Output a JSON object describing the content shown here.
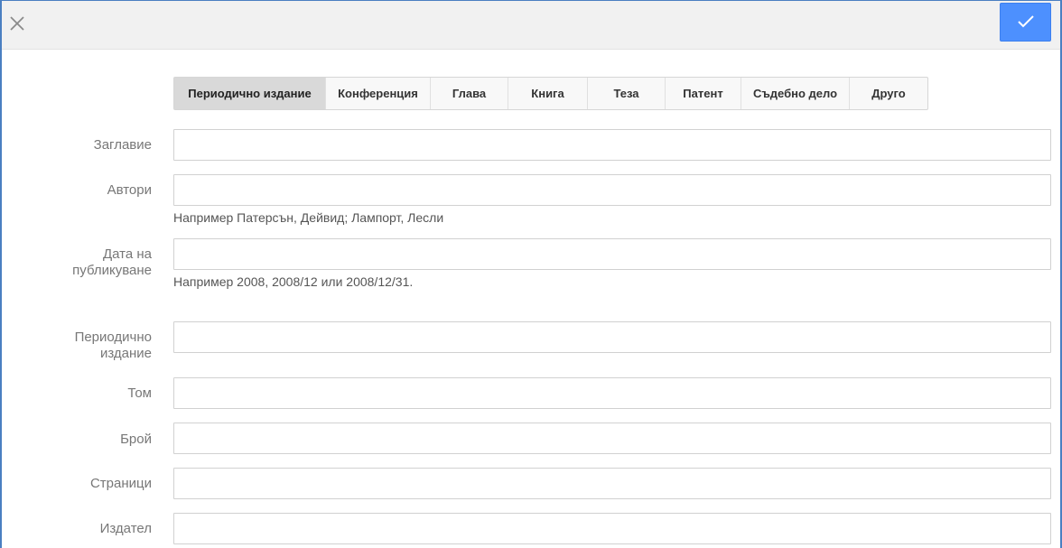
{
  "toolbar": {
    "close_icon": "close-icon",
    "save_icon": "checkmark-icon",
    "accent_color": "#4d90fe"
  },
  "tabs": [
    {
      "label": "Периодично издание",
      "active": true
    },
    {
      "label": "Конференция",
      "active": false
    },
    {
      "label": "Глава",
      "active": false
    },
    {
      "label": "Книга",
      "active": false
    },
    {
      "label": "Теза",
      "active": false
    },
    {
      "label": "Патент",
      "active": false
    },
    {
      "label": "Съдебно дело",
      "active": false
    },
    {
      "label": "Друго",
      "active": false
    }
  ],
  "form": {
    "title": {
      "label": "Заглавие",
      "value": ""
    },
    "authors": {
      "label": "Автори",
      "value": "",
      "hint": "Например Патерсън, Дейвид; Лампорт, Лесли"
    },
    "publication_date": {
      "label_line1": "Дата на",
      "label_line2": "публикуване",
      "value": "",
      "hint": "Например 2008, 2008/12 или 2008/12/31."
    },
    "journal": {
      "label_line1": "Периодично",
      "label_line2": "издание",
      "value": ""
    },
    "volume": {
      "label": "Том",
      "value": ""
    },
    "issue": {
      "label": "Брой",
      "value": ""
    },
    "pages": {
      "label": "Страници",
      "value": ""
    },
    "publisher": {
      "label": "Издател",
      "value": ""
    }
  }
}
